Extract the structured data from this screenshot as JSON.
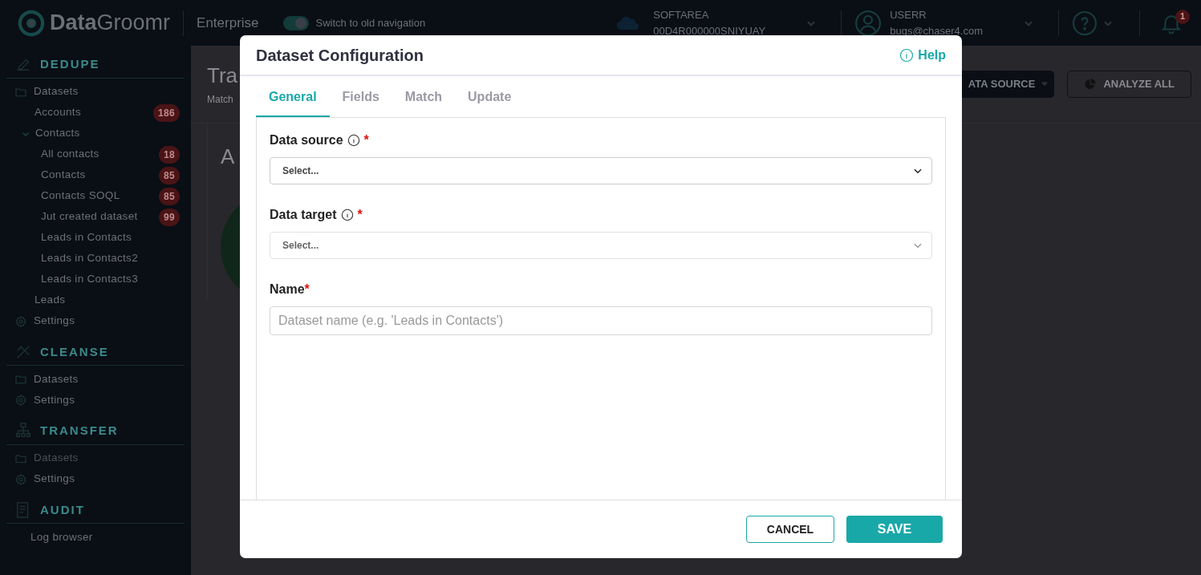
{
  "app": {
    "logo_bold": "Data",
    "logo_light": "Groomr",
    "edition": "Enterprise",
    "nav_toggle": {
      "label": "Switch to old navigation",
      "on": true
    }
  },
  "org": {
    "name": "SOFTAREA",
    "id": "00D4R000000SNIYUAY"
  },
  "user": {
    "name": "USERR",
    "email": "bugs@chaser4.com"
  },
  "notifications": {
    "count": "1"
  },
  "sidebar": {
    "sections": [
      {
        "title": "DEDUPE",
        "kind": "dedupe",
        "items": [
          {
            "label": "Datasets",
            "kind": "folder",
            "disabled": false,
            "children": [
              {
                "label": "Accounts",
                "badge": "186"
              },
              {
                "label": "Contacts",
                "expanded": true,
                "children": [
                  {
                    "label": "All contacts",
                    "badge": "18"
                  },
                  {
                    "label": "Contacts",
                    "badge": "85"
                  },
                  {
                    "label": "Contacts SOQL",
                    "badge": "85"
                  },
                  {
                    "label": "Jut created dataset",
                    "badge": "99"
                  },
                  {
                    "label": "Leads in Contacts"
                  },
                  {
                    "label": "Leads in Contacts2"
                  },
                  {
                    "label": "Leads in Contacts3"
                  }
                ]
              },
              {
                "label": "Leads"
              }
            ]
          },
          {
            "label": "Settings",
            "kind": "settings",
            "disabled": false
          }
        ]
      },
      {
        "title": "CLEANSE",
        "kind": "cleanse",
        "items": [
          {
            "label": "Datasets",
            "kind": "folder",
            "disabled": false
          },
          {
            "label": "Settings",
            "kind": "settings",
            "disabled": false
          }
        ]
      },
      {
        "title": "TRANSFER",
        "kind": "transfer",
        "items": [
          {
            "label": "Datasets",
            "kind": "folder",
            "disabled": true
          },
          {
            "label": "Settings",
            "kind": "settings",
            "disabled": false
          }
        ]
      },
      {
        "title": "AUDIT",
        "kind": "audit",
        "items": [
          {
            "label": "Log browser",
            "kind": "plain",
            "disabled": false
          }
        ]
      }
    ]
  },
  "page": {
    "title": "Tra",
    "subtitle": "Match",
    "card_title": "A",
    "buttons": [
      {
        "label": "ATA SOURCE",
        "kind": "dropdown"
      },
      {
        "label": "ANALYZE ALL",
        "kind": "outline"
      }
    ]
  },
  "modal": {
    "title": "Dataset Configuration",
    "help": "Help",
    "tabs": [
      {
        "label": "General",
        "selected": true
      },
      {
        "label": "Fields",
        "selected": false
      },
      {
        "label": "Match",
        "selected": false
      },
      {
        "label": "Update",
        "selected": false
      }
    ],
    "fields": [
      {
        "label": "Data source",
        "info": true,
        "required_mark": "*",
        "kind": "select",
        "value": "Select...",
        "disabled": false
      },
      {
        "label": "Data target",
        "info": true,
        "required_mark": "*",
        "kind": "select",
        "value": "Select...",
        "disabled": true
      },
      {
        "label": "Name",
        "info": false,
        "required_mark": "*",
        "kind": "text",
        "placeholder": "Dataset name (e.g. 'Leads in Contacts')"
      }
    ],
    "buttons": [
      {
        "label": "CANCEL",
        "kind": "outline"
      },
      {
        "label": "SAVE",
        "kind": "primary"
      }
    ]
  }
}
